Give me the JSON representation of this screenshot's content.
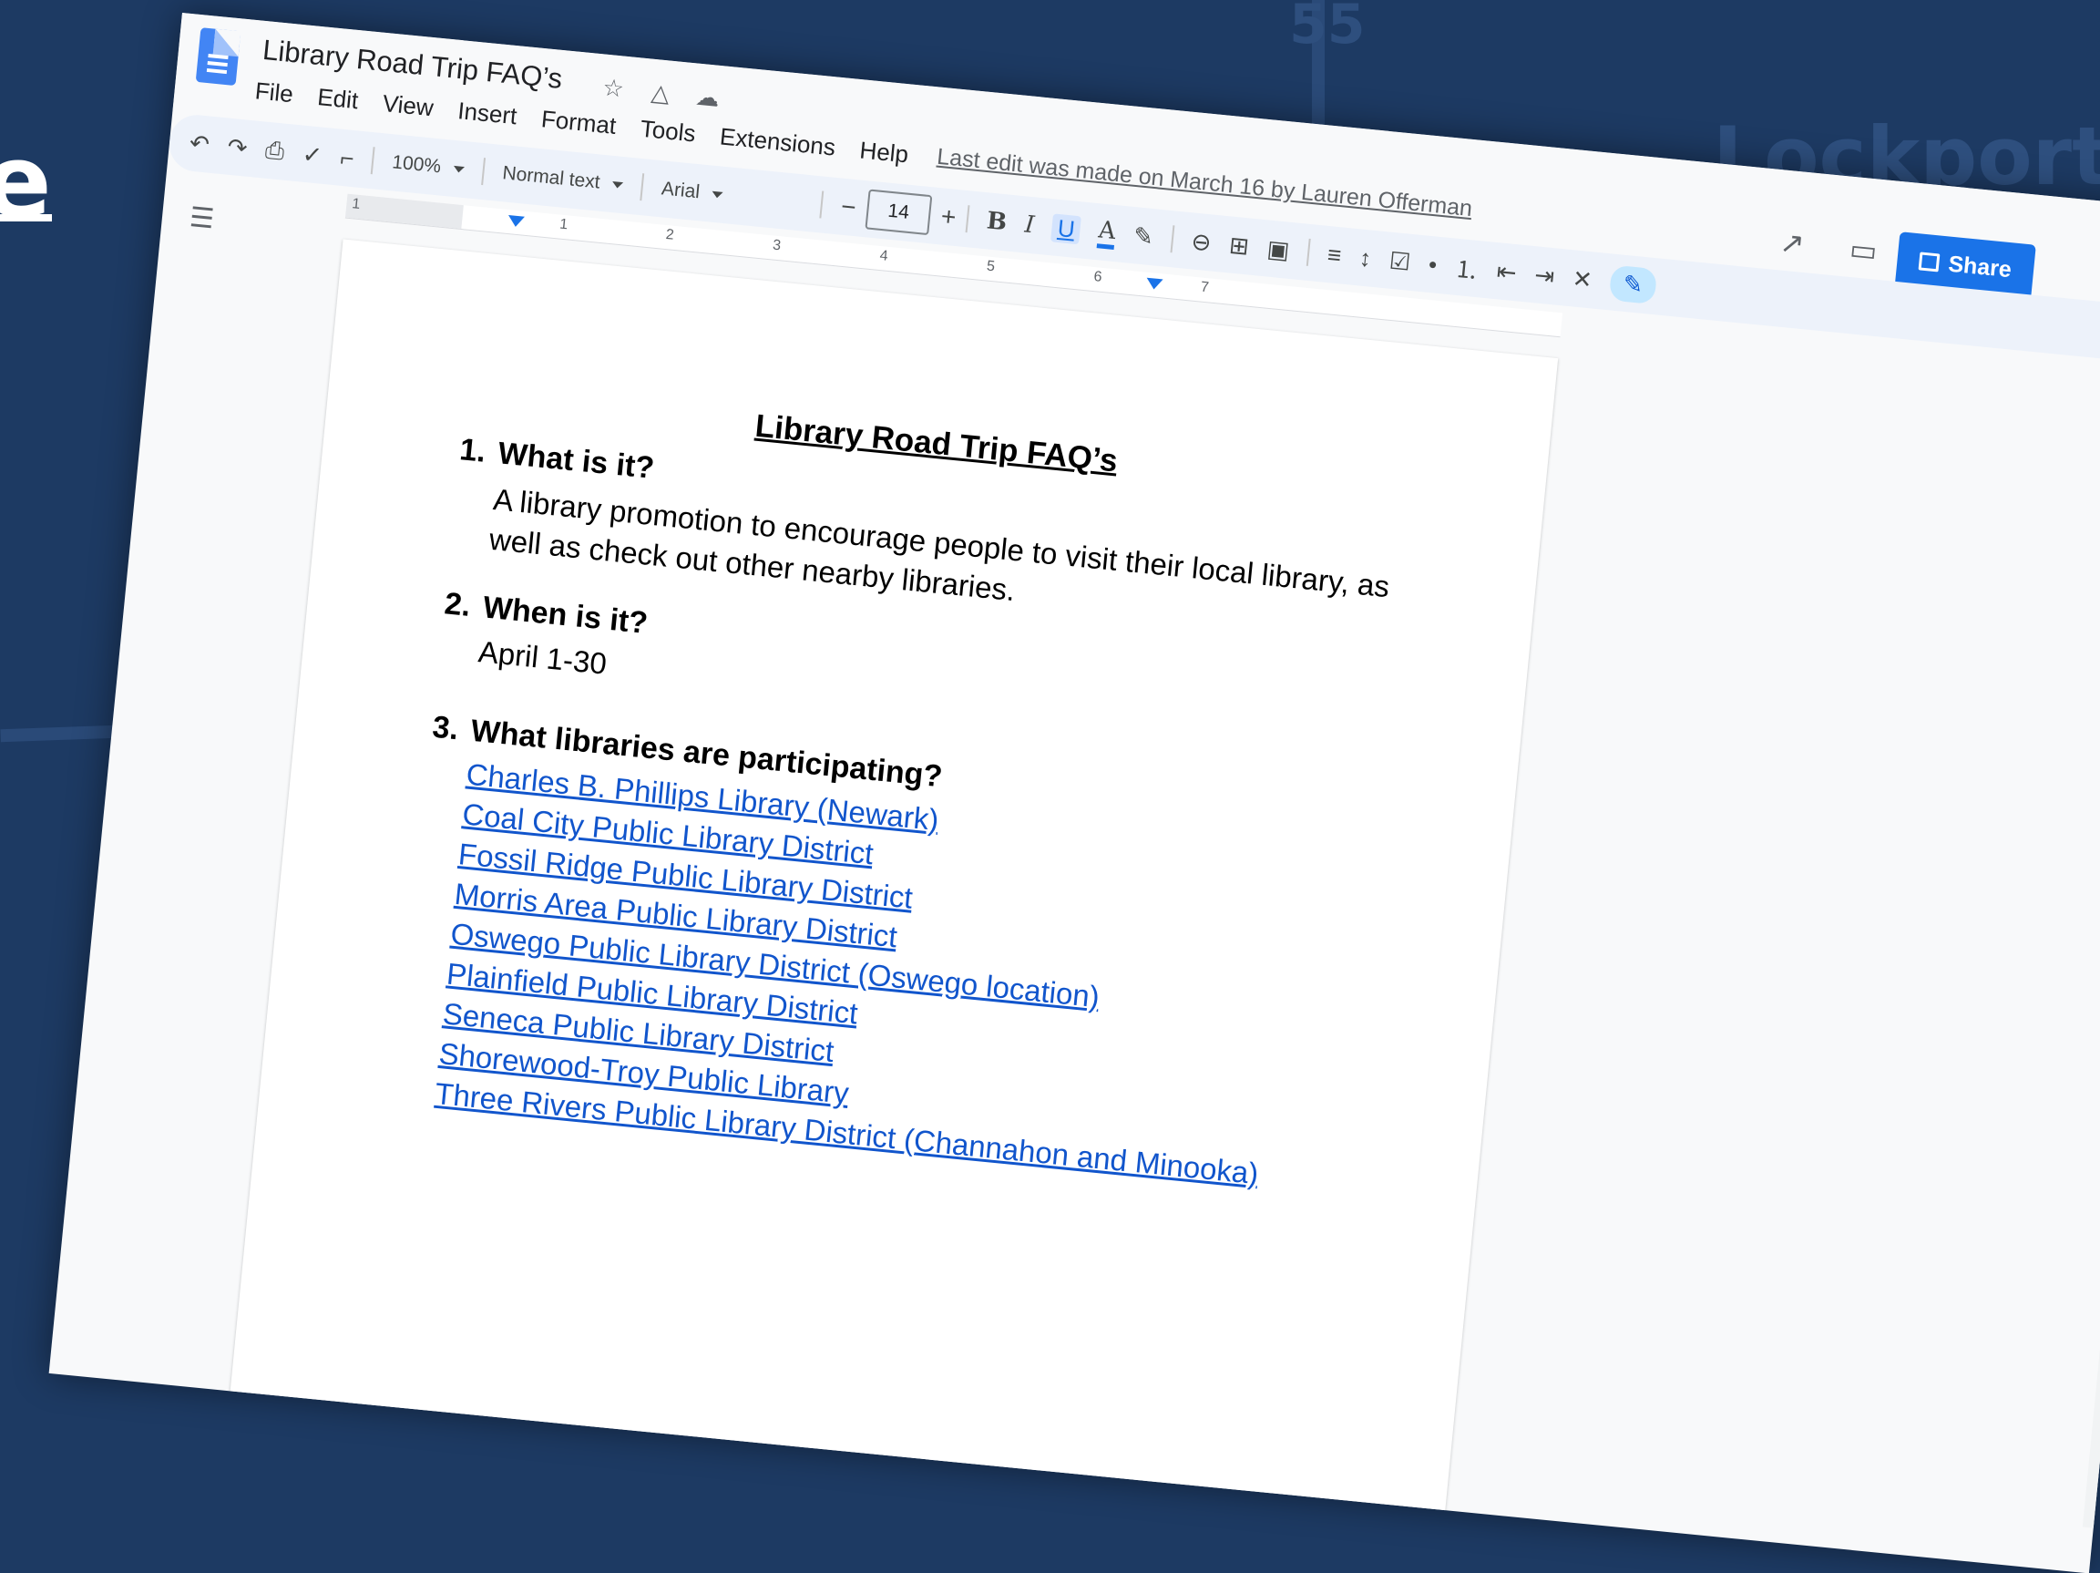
{
  "app": {
    "doc_title": "Library Road Trip FAQ’s",
    "menu": [
      "File",
      "Edit",
      "View",
      "Insert",
      "Format",
      "Tools",
      "Extensions",
      "Help"
    ],
    "last_edit": "Last edit was made on March 16 by Lauren Offerman",
    "share_label": "Share"
  },
  "toolbar": {
    "zoom": "100%",
    "style": "Normal text",
    "font": "Arial",
    "font_size": "14",
    "minus": "−",
    "plus": "+",
    "bold": "B",
    "italic": "I",
    "underline": "U",
    "text_color": "A"
  },
  "ruler": {
    "numbers": [
      "1",
      "1",
      "2",
      "3",
      "4",
      "5",
      "6",
      "7"
    ]
  },
  "document": {
    "heading": "Library Road Trip FAQ’s",
    "questions": [
      {
        "num": "1.",
        "text": "What is it?"
      },
      {
        "num": "2.",
        "text": "When is it?"
      },
      {
        "num": "3.",
        "text": "What libraries are participating?"
      }
    ],
    "answers": [
      "A library promotion to encourage people to visit their local library, as well as check out other nearby libraries.",
      "April 1-30"
    ],
    "libraries": [
      "Charles B. Phillips Library (Newark)",
      "Coal City Public Library District",
      "Fossil Ridge Public Library District",
      "Morris Area Public Library District",
      "Oswego Public Library District (Oswego location)",
      "Plainfield Public Library District",
      "Seneca Public Library District",
      "Shorewood-Troy Public Library",
      "Three Rivers Public Library District (Channahon and Minooka)"
    ]
  },
  "background": {
    "map_labels": [
      "Lockport",
      "55"
    ],
    "edge_text": "e"
  },
  "colors": {
    "background": "#1d3a63",
    "accent": "#1a73e8",
    "link": "#1155cc"
  }
}
